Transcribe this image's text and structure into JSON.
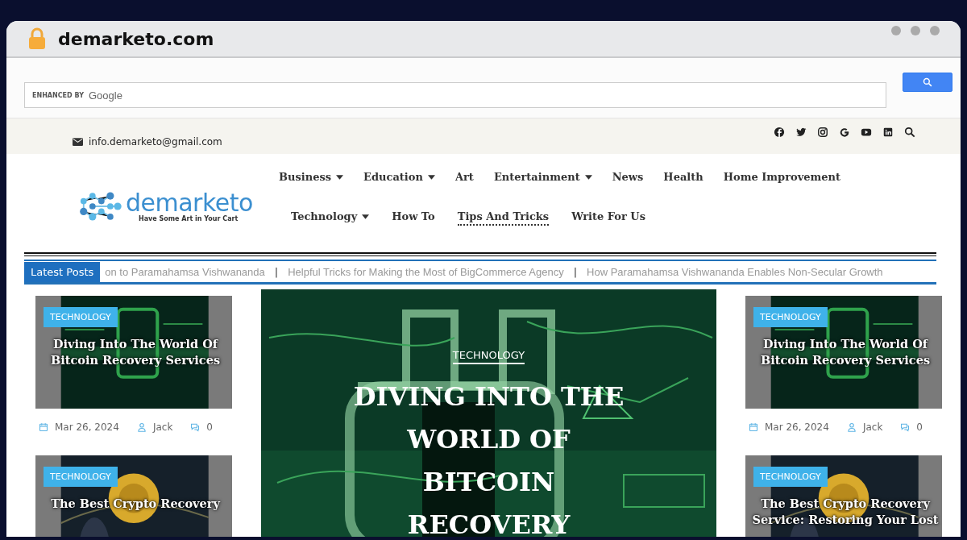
{
  "browser": {
    "address": "demarketo.com"
  },
  "search": {
    "branding": "ENHANCED BY",
    "brand": "Google"
  },
  "top_bar": {
    "email": "info.demarketo@gmail.com"
  },
  "logo": {
    "name": "demarketo",
    "tagline": "Have Some Art in Your Cart"
  },
  "nav": {
    "rows": [
      {
        "items": [
          {
            "label": "Business",
            "dropdown": true,
            "selected": false
          },
          {
            "label": "Education",
            "dropdown": true,
            "selected": false
          },
          {
            "label": "Art",
            "dropdown": false,
            "selected": false
          },
          {
            "label": "Entertainment",
            "dropdown": true,
            "selected": false
          },
          {
            "label": "News",
            "dropdown": false,
            "selected": false
          },
          {
            "label": "Health",
            "dropdown": false,
            "selected": false
          },
          {
            "label": "Home Improvement",
            "dropdown": false,
            "selected": false
          }
        ]
      },
      {
        "items": [
          {
            "label": "Technology",
            "dropdown": true,
            "selected": false
          },
          {
            "label": "How To",
            "dropdown": false,
            "selected": false
          },
          {
            "label": "Tips And Tricks",
            "dropdown": false,
            "selected": true
          },
          {
            "label": "Write For Us",
            "dropdown": false,
            "selected": false
          }
        ]
      }
    ]
  },
  "ticker": {
    "label": "Latest Posts",
    "separator": "|",
    "items": [
      "on to Paramahamsa Vishwananda",
      "Helpful Tricks for Making the Most of BigCommerce Agency",
      "How Paramahamsa Vishwananda Enables Non-Secular Growth"
    ]
  },
  "left_posts": [
    {
      "kind": "green",
      "category": "TECHNOLOGY",
      "title": "Diving Into The World Of Bitcoin Recovery Services",
      "date": "Mar 26, 2024",
      "author": "Jack",
      "comments": "0"
    },
    {
      "kind": "gold",
      "category": "TECHNOLOGY",
      "title": "The Best Crypto Recovery"
    }
  ],
  "featured": {
    "category": "TECHNOLOGY",
    "title": "DIVING INTO THE WORLD OF BITCOIN RECOVERY"
  },
  "right_posts": [
    {
      "kind": "green",
      "category": "TECHNOLOGY",
      "title": "Diving Into The World Of Bitcoin Recovery Services",
      "date": "Mar 26, 2024",
      "author": "Jack",
      "comments": "0"
    },
    {
      "kind": "gold",
      "category": "TECHNOLOGY",
      "title": "The Best Crypto Recovery Service: Restoring Your Lost"
    }
  ]
}
